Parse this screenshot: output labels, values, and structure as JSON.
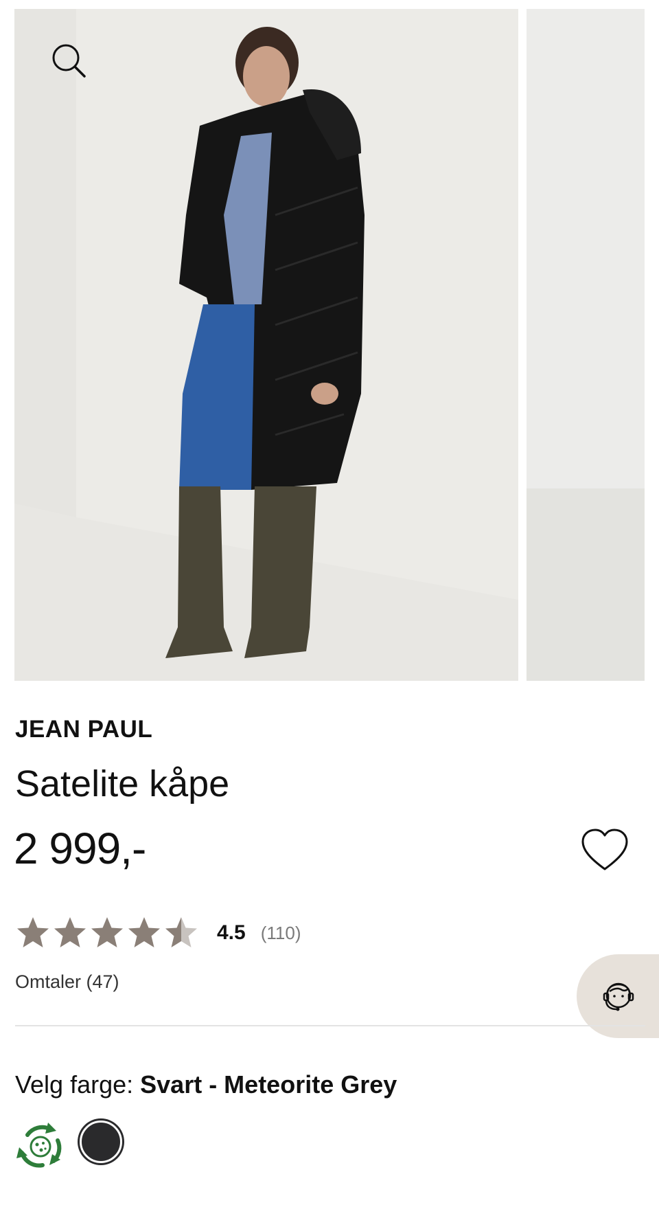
{
  "product": {
    "brand": "JEAN PAUL",
    "name": "Satelite kåpe",
    "price": "2 999,-"
  },
  "rating": {
    "value": "4.5",
    "count": "(110)",
    "stars_filled": 4.5,
    "stars_total": 5,
    "star_color": "#8a7f77",
    "star_empty_color": "#c8c3bf"
  },
  "reviews": {
    "label": "Omtaler (47)"
  },
  "color_selector": {
    "label": "Velg farge:",
    "selected": "Svart - Meteorite Grey",
    "swatch_color": "#2a2a2c",
    "eco_badge_color": "#2e7d3a"
  },
  "icons": {
    "search": "search-icon",
    "favorite": "heart-icon",
    "support": "customer-support-icon",
    "eco": "recycle-icon"
  },
  "theme": {
    "support_bg": "#e7e1da",
    "divider": "#e3e3e3"
  }
}
